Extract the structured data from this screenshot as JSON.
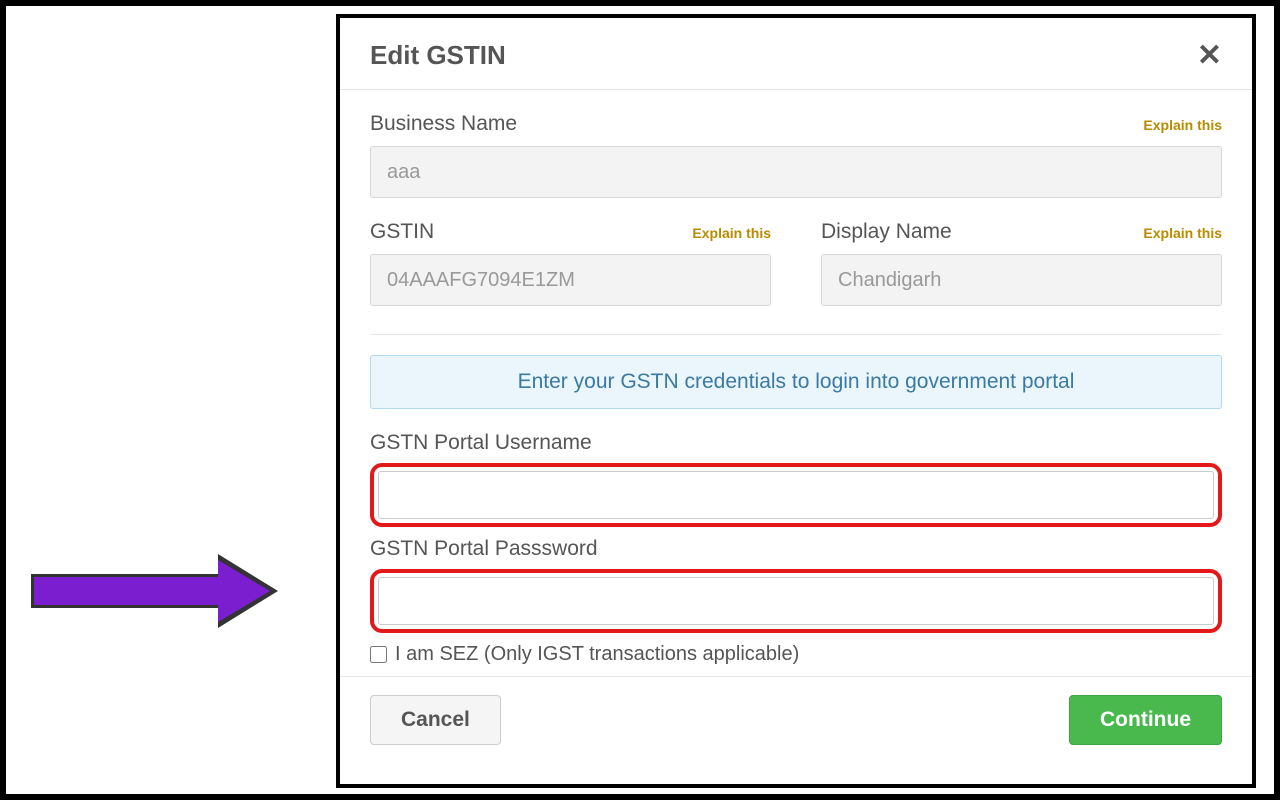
{
  "modal": {
    "title": "Edit GSTIN",
    "business_name": {
      "label": "Business Name",
      "explain": "Explain this",
      "value": "aaa"
    },
    "gstin": {
      "label": "GSTIN",
      "explain": "Explain this",
      "value": "04AAAFG7094E1ZM"
    },
    "display_name": {
      "label": "Display Name",
      "explain": "Explain this",
      "value": "Chandigarh"
    },
    "info_banner": "Enter your GSTN credentials to login into government portal",
    "username": {
      "label": "GSTN Portal Username",
      "value": ""
    },
    "password": {
      "label": "GSTN Portal Passsword",
      "value": ""
    },
    "sez_label": "I am SEZ (Only IGST transactions applicable)",
    "footer": {
      "cancel": "Cancel",
      "continue": "Continue"
    }
  }
}
